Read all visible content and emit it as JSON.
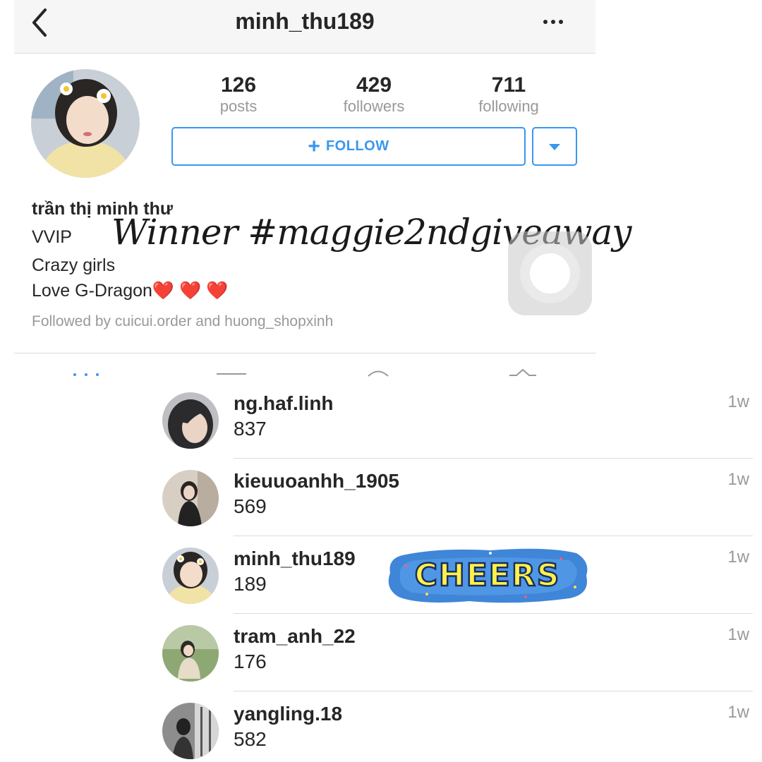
{
  "profile": {
    "username": "minh_thu189",
    "stats": [
      {
        "value": "126",
        "label": "posts"
      },
      {
        "value": "429",
        "label": "followers"
      },
      {
        "value": "711",
        "label": "following"
      }
    ],
    "follow_button": {
      "icon": "+",
      "label": "FOLLOW"
    },
    "full_name": "trần thị minh thư",
    "bio": [
      "VVIP",
      "Crazy girls",
      "Love G-Dragon❤️ ❤️ ❤️"
    ],
    "followed_by": "Followed by cuicui.order and huong_shopxinh"
  },
  "overlay": {
    "title": "Winner #maggie2ndgiveaway",
    "sticker": "CHEERS"
  },
  "comments": [
    {
      "username": "ng.haf.linh",
      "text": "837",
      "time": "1w"
    },
    {
      "username": "kieuuoanhh_1905",
      "text": "569",
      "time": "1w"
    },
    {
      "username": "minh_thu189",
      "text": "189",
      "time": "1w"
    },
    {
      "username": "tram_anh_22",
      "text": "176",
      "time": "1w"
    },
    {
      "username": "yangling.18",
      "text": "582",
      "time": "1w"
    }
  ],
  "colors": {
    "accent": "#3897f0",
    "text": "#262626",
    "muted": "#999999"
  }
}
